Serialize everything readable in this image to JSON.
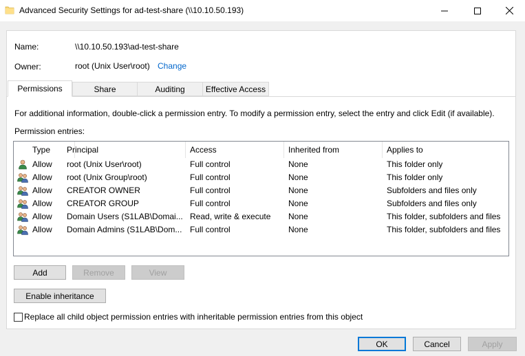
{
  "window": {
    "title": "Advanced Security Settings for ad-test-share (\\\\10.10.50.193)",
    "icon": "folder-icon"
  },
  "info": {
    "name_label": "Name:",
    "name_value": "\\\\10.10.50.193\\ad-test-share",
    "owner_label": "Owner:",
    "owner_value": "root (Unix User\\root)",
    "change_link": "Change"
  },
  "tabs": [
    {
      "label": "Permissions",
      "active": true
    },
    {
      "label": "Share",
      "active": false
    },
    {
      "label": "Auditing",
      "active": false
    },
    {
      "label": "Effective Access",
      "active": false
    }
  ],
  "permissions": {
    "info_text": "For additional information, double-click a permission entry. To modify a permission entry, select the entry and click Edit (if available).",
    "entries_label": "Permission entries:",
    "columns": [
      "Type",
      "Principal",
      "Access",
      "Inherited from",
      "Applies to"
    ],
    "rows": [
      {
        "icon": "user-icon",
        "type": "Allow",
        "principal": "root (Unix User\\root)",
        "access": "Full control",
        "inherited": "None",
        "applies": "This folder only"
      },
      {
        "icon": "group-icon",
        "type": "Allow",
        "principal": "root (Unix Group\\root)",
        "access": "Full control",
        "inherited": "None",
        "applies": "This folder only"
      },
      {
        "icon": "group-icon",
        "type": "Allow",
        "principal": "CREATOR OWNER",
        "access": "Full control",
        "inherited": "None",
        "applies": "Subfolders and files only"
      },
      {
        "icon": "group-icon",
        "type": "Allow",
        "principal": "CREATOR GROUP",
        "access": "Full control",
        "inherited": "None",
        "applies": "Subfolders and files only"
      },
      {
        "icon": "group-icon",
        "type": "Allow",
        "principal": "Domain Users (S1LAB\\Domai...",
        "access": "Read, write & execute",
        "inherited": "None",
        "applies": "This folder, subfolders and files"
      },
      {
        "icon": "group-icon",
        "type": "Allow",
        "principal": "Domain Admins (S1LAB\\Dom...",
        "access": "Full control",
        "inherited": "None",
        "applies": "This folder, subfolders and files"
      }
    ]
  },
  "buttons": {
    "add": "Add",
    "remove": "Remove",
    "view": "View",
    "enable_inheritance": "Enable inheritance",
    "ok": "OK",
    "cancel": "Cancel",
    "apply": "Apply"
  },
  "replace_checkbox": {
    "label": "Replace all child object permission entries with inheritable permission entries from this object",
    "checked": false
  },
  "colors": {
    "link": "#0066cc",
    "focus_border": "#0078d7",
    "dialog_bg": "#f0f0f0"
  }
}
